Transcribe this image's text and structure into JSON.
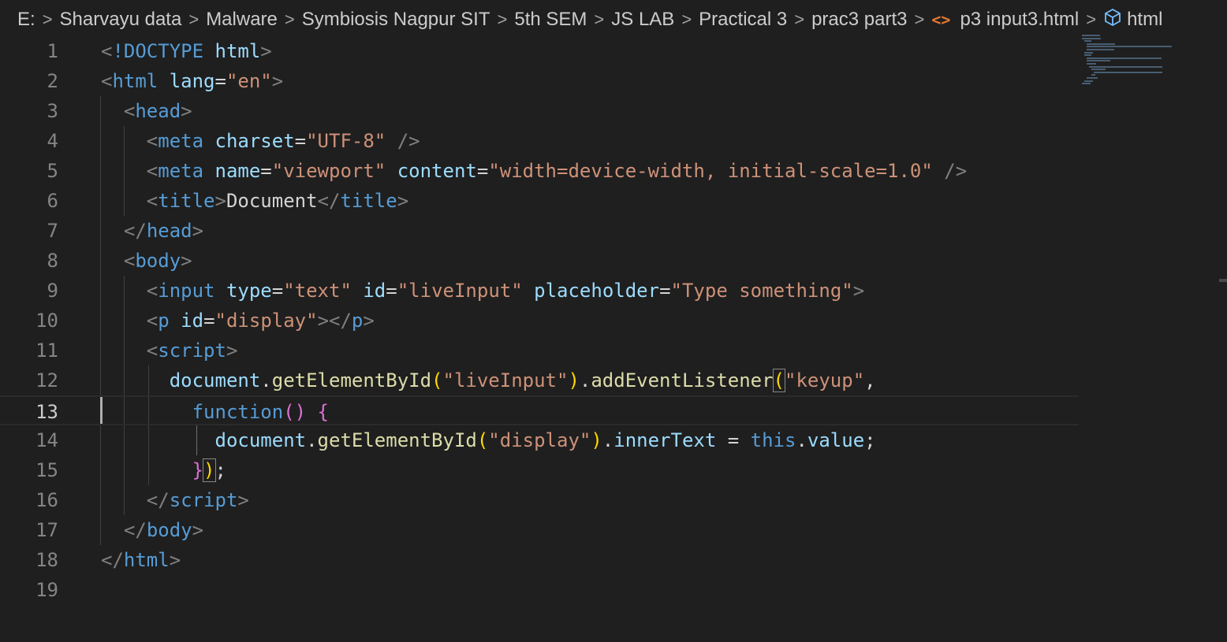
{
  "breadcrumb": {
    "items": [
      "E:",
      "Sharvayu data",
      "Malware",
      "Symbiosis Nagpur SIT",
      "5th SEM",
      "JS LAB",
      "Practical 3",
      "prac3 part3",
      "p3 input3.html",
      "html"
    ],
    "file_icon": "code-brackets-icon",
    "element_icon": "cube-icon"
  },
  "editor": {
    "active_line": 13,
    "lines": [
      {
        "n": "1",
        "tokens": [
          [
            "tag",
            "<"
          ],
          [
            "tn",
            "!DOCTYPE"
          ],
          [
            "txt",
            " "
          ],
          [
            "at",
            "html"
          ],
          [
            "tag",
            ">"
          ]
        ]
      },
      {
        "n": "2",
        "tokens": [
          [
            "tag",
            "<"
          ],
          [
            "tn",
            "html"
          ],
          [
            "txt",
            " "
          ],
          [
            "at",
            "lang"
          ],
          [
            "txt",
            "="
          ],
          [
            "str",
            "\"en\""
          ],
          [
            "tag",
            ">"
          ]
        ]
      },
      {
        "n": "3",
        "tokens": [
          [
            "txt",
            "  "
          ],
          [
            "tag",
            "<"
          ],
          [
            "tn",
            "head"
          ],
          [
            "tag",
            ">"
          ]
        ]
      },
      {
        "n": "4",
        "tokens": [
          [
            "txt",
            "    "
          ],
          [
            "tag",
            "<"
          ],
          [
            "tn",
            "meta"
          ],
          [
            "txt",
            " "
          ],
          [
            "at",
            "charset"
          ],
          [
            "txt",
            "="
          ],
          [
            "str",
            "\"UTF-8\""
          ],
          [
            "txt",
            " "
          ],
          [
            "tag",
            "/>"
          ]
        ]
      },
      {
        "n": "5",
        "tokens": [
          [
            "txt",
            "    "
          ],
          [
            "tag",
            "<"
          ],
          [
            "tn",
            "meta"
          ],
          [
            "txt",
            " "
          ],
          [
            "at",
            "name"
          ],
          [
            "txt",
            "="
          ],
          [
            "str",
            "\"viewport\""
          ],
          [
            "txt",
            " "
          ],
          [
            "at",
            "content"
          ],
          [
            "txt",
            "="
          ],
          [
            "str",
            "\"width=device-width, initial-scale=1.0\""
          ],
          [
            "txt",
            " "
          ],
          [
            "tag",
            "/>"
          ]
        ]
      },
      {
        "n": "6",
        "tokens": [
          [
            "txt",
            "    "
          ],
          [
            "tag",
            "<"
          ],
          [
            "tn",
            "title"
          ],
          [
            "tag",
            ">"
          ],
          [
            "txt",
            "Document"
          ],
          [
            "tag",
            "</"
          ],
          [
            "tn",
            "title"
          ],
          [
            "tag",
            ">"
          ]
        ]
      },
      {
        "n": "7",
        "tokens": [
          [
            "txt",
            "  "
          ],
          [
            "tag",
            "</"
          ],
          [
            "tn",
            "head"
          ],
          [
            "tag",
            ">"
          ]
        ]
      },
      {
        "n": "8",
        "tokens": [
          [
            "txt",
            "  "
          ],
          [
            "tag",
            "<"
          ],
          [
            "tn",
            "body"
          ],
          [
            "tag",
            ">"
          ]
        ]
      },
      {
        "n": "9",
        "tokens": [
          [
            "txt",
            "    "
          ],
          [
            "tag",
            "<"
          ],
          [
            "tn",
            "input"
          ],
          [
            "txt",
            " "
          ],
          [
            "at",
            "type"
          ],
          [
            "txt",
            "="
          ],
          [
            "str",
            "\"text\""
          ],
          [
            "txt",
            " "
          ],
          [
            "at",
            "id"
          ],
          [
            "txt",
            "="
          ],
          [
            "str",
            "\"liveInput\""
          ],
          [
            "txt",
            " "
          ],
          [
            "at",
            "placeholder"
          ],
          [
            "txt",
            "="
          ],
          [
            "str",
            "\"Type something\""
          ],
          [
            "tag",
            ">"
          ]
        ]
      },
      {
        "n": "10",
        "tokens": [
          [
            "txt",
            "    "
          ],
          [
            "tag",
            "<"
          ],
          [
            "tn",
            "p"
          ],
          [
            "txt",
            " "
          ],
          [
            "at",
            "id"
          ],
          [
            "txt",
            "="
          ],
          [
            "str",
            "\"display\""
          ],
          [
            "tag",
            "></"
          ],
          [
            "tn",
            "p"
          ],
          [
            "tag",
            ">"
          ]
        ]
      },
      {
        "n": "11",
        "tokens": [
          [
            "txt",
            "    "
          ],
          [
            "tag",
            "<"
          ],
          [
            "tn",
            "script"
          ],
          [
            "tag",
            ">"
          ]
        ]
      },
      {
        "n": "12",
        "tokens": [
          [
            "txt",
            "      "
          ],
          [
            "id",
            "document"
          ],
          [
            "txt",
            "."
          ],
          [
            "fn",
            "getElementById"
          ],
          [
            "br1",
            "("
          ],
          [
            "str",
            "\"liveInput\""
          ],
          [
            "br1",
            ")"
          ],
          [
            "txt",
            "."
          ],
          [
            "fn",
            "addEventListener"
          ],
          [
            "br1b",
            "("
          ],
          [
            "str",
            "\"keyup\""
          ],
          [
            "txt",
            ","
          ]
        ]
      },
      {
        "n": "13",
        "tokens": [
          [
            "txt",
            "        "
          ],
          [
            "kw",
            "function"
          ],
          [
            "br2",
            "()"
          ],
          [
            "txt",
            " "
          ],
          [
            "br2",
            "{"
          ]
        ]
      },
      {
        "n": "14",
        "tokens": [
          [
            "txt",
            "          "
          ],
          [
            "id",
            "document"
          ],
          [
            "txt",
            "."
          ],
          [
            "fn",
            "getElementById"
          ],
          [
            "br1",
            "("
          ],
          [
            "str",
            "\"display\""
          ],
          [
            "br1",
            ")"
          ],
          [
            "txt",
            "."
          ],
          [
            "id",
            "innerText"
          ],
          [
            "txt",
            " = "
          ],
          [
            "kw",
            "this"
          ],
          [
            "txt",
            "."
          ],
          [
            "id",
            "value"
          ],
          [
            "txt",
            ";"
          ]
        ]
      },
      {
        "n": "15",
        "tokens": [
          [
            "txt",
            "        "
          ],
          [
            "br2",
            "}"
          ],
          [
            "br1b",
            ")"
          ],
          [
            "txt",
            ";"
          ]
        ]
      },
      {
        "n": "16",
        "tokens": [
          [
            "txt",
            "    "
          ],
          [
            "tag",
            "</"
          ],
          [
            "tn",
            "script"
          ],
          [
            "tag",
            ">"
          ]
        ]
      },
      {
        "n": "17",
        "tokens": [
          [
            "txt",
            "  "
          ],
          [
            "tag",
            "</"
          ],
          [
            "tn",
            "body"
          ],
          [
            "tag",
            ">"
          ]
        ]
      },
      {
        "n": "18",
        "tokens": [
          [
            "tag",
            "</"
          ],
          [
            "tn",
            "html"
          ],
          [
            "tag",
            ">"
          ]
        ]
      },
      {
        "n": "19",
        "tokens": []
      }
    ]
  },
  "colors": {
    "background": "#1f1f1f",
    "tag_name": "#569cd6",
    "attribute": "#9cdcfe",
    "string": "#ce9178",
    "function": "#dcdcaa",
    "bracket_gold": "#ffd700",
    "bracket_purple": "#da70d6"
  }
}
